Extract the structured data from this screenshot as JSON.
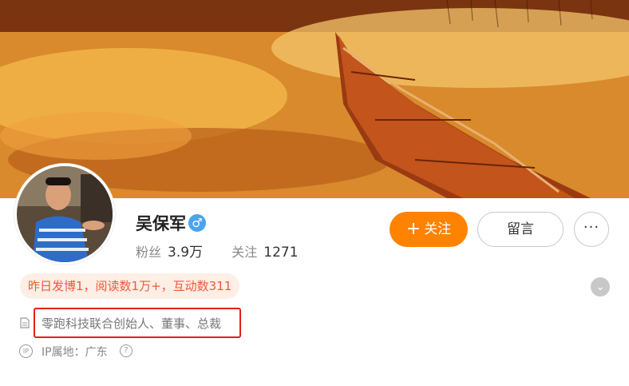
{
  "profile": {
    "name": "吴保军",
    "gender_icon": "male-icon",
    "gender_symbol": "♂",
    "followers_label": "粉丝",
    "followers_value": "3.9万",
    "following_label": "关注",
    "following_value": "1271"
  },
  "actions": {
    "follow_plus": "+",
    "follow_label": "关注",
    "message_label": "留言",
    "more_label": "···"
  },
  "activity": {
    "text": "昨日发博1，阅读数1万+，互动数311",
    "expand_icon": "chevron-down-icon"
  },
  "bio": {
    "icon": "document-icon",
    "text": "零跑科技联合创始人、董事、总裁"
  },
  "location": {
    "icon": "ip-icon",
    "icon_text": "IP",
    "text": "IP属地：广东",
    "help_icon": "question-icon",
    "help_symbol": "?"
  },
  "colors": {
    "accent": "#ff8200",
    "activity_text": "#ef5a3a",
    "activity_bg": "#fdeee6",
    "highlight_border": "#e02020",
    "gender": "#4aa3f0"
  }
}
